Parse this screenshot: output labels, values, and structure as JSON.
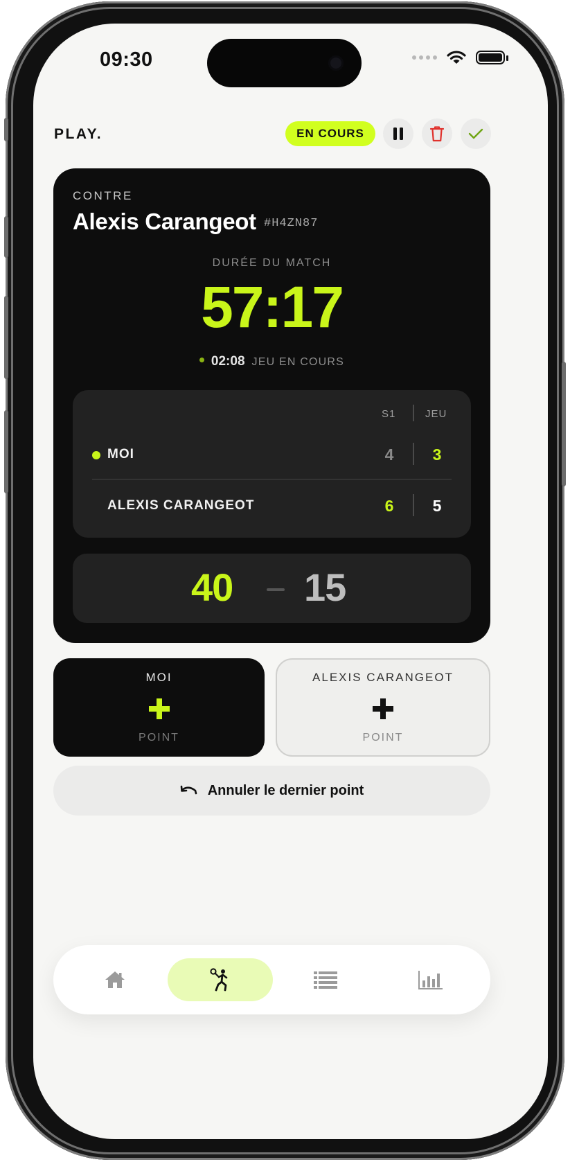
{
  "status_bar": {
    "time": "09:30"
  },
  "header": {
    "brand": "PLAY.",
    "status_pill": "EN COURS",
    "actions": {
      "pause_icon": "pause-icon",
      "delete_icon": "trash-icon",
      "finish_icon": "check-icon"
    }
  },
  "match": {
    "contre_label": "CONTRE",
    "opponent_name": "Alexis Carangeot",
    "opponent_tag": "#H4ZN87",
    "duration_label": "DURÉE DU MATCH",
    "duration": "57:17",
    "game_time": "02:08",
    "game_label": "JEU EN COURS"
  },
  "scoreboard": {
    "headers": {
      "set": "S1",
      "game": "JEU"
    },
    "rows": [
      {
        "name": "MOI",
        "set": "4",
        "game": "3",
        "serving": true
      },
      {
        "name": "ALEXIS CARANGEOT",
        "set": "6",
        "game": "5",
        "serving": false
      }
    ],
    "points": {
      "me": "40",
      "opponent": "15"
    }
  },
  "point_buttons": {
    "me": {
      "name": "MOI",
      "label": "POINT"
    },
    "opponent": {
      "name": "ALEXIS CARANGEOT",
      "label": "POINT"
    }
  },
  "undo": {
    "label": "Annuler le dernier point"
  },
  "tabbar": {
    "tabs": [
      "home-icon",
      "tennis-player-icon",
      "list-icon",
      "bar-chart-icon"
    ],
    "active_index": 1
  },
  "colors": {
    "accent": "#c9f51a",
    "pill": "#d1ff1f",
    "card": "#0d0d0d",
    "panel": "#222222",
    "delete": "#e0312c"
  }
}
